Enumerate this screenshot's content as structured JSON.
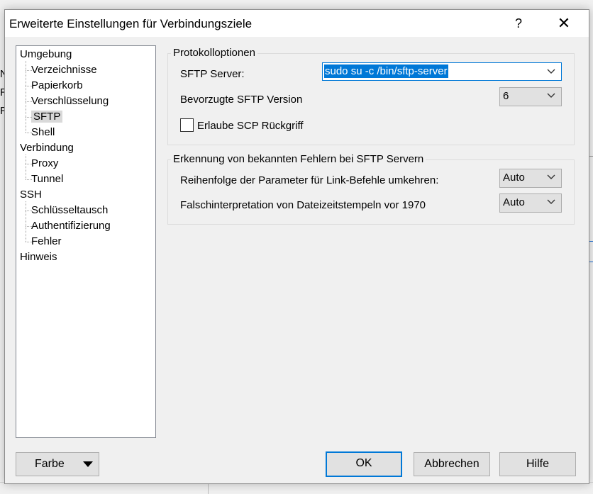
{
  "dialog": {
    "title": "Erweiterte Einstellungen für Verbindungsziele",
    "help_label": "?",
    "close_label": "✕"
  },
  "background": {
    "left_letters": [
      "N",
      "R",
      "R"
    ]
  },
  "tree": {
    "items": [
      {
        "label": "Umgebung",
        "level": 0
      },
      {
        "label": "Verzeichnisse",
        "level": 1
      },
      {
        "label": "Papierkorb",
        "level": 1
      },
      {
        "label": "Verschlüsselung",
        "level": 1
      },
      {
        "label": "SFTP",
        "level": 1,
        "selected": true
      },
      {
        "label": "Shell",
        "level": 1
      },
      {
        "label": "Verbindung",
        "level": 0
      },
      {
        "label": "Proxy",
        "level": 1
      },
      {
        "label": "Tunnel",
        "level": 1
      },
      {
        "label": "SSH",
        "level": 0
      },
      {
        "label": "Schlüsseltausch",
        "level": 1
      },
      {
        "label": "Authentifizierung",
        "level": 1
      },
      {
        "label": "Fehler",
        "level": 1
      },
      {
        "label": "Hinweis",
        "level": 0
      }
    ]
  },
  "protocol": {
    "group_title": "Protokolloptionen",
    "sftp_server_label": "SFTP Server:",
    "sftp_server_value": "sudo su -c /bin/sftp-server",
    "version_label": "Bevorzugte SFTP Version",
    "version_value": "6",
    "scp_label": "Erlaube SCP Rückgriff",
    "scp_checked": false
  },
  "bugs": {
    "group_title": "Erkennung von bekannten Fehlern bei SFTP Servern",
    "reverse_label": "Reihenfolge der Parameter für Link-Befehle umkehren:",
    "reverse_value": "Auto",
    "timestamp_label": "Falschinterpretation von Dateizeitstempeln vor 1970",
    "timestamp_value": "Auto"
  },
  "buttons": {
    "color": "Farbe",
    "ok": "OK",
    "cancel": "Abbrechen",
    "help": "Hilfe"
  }
}
